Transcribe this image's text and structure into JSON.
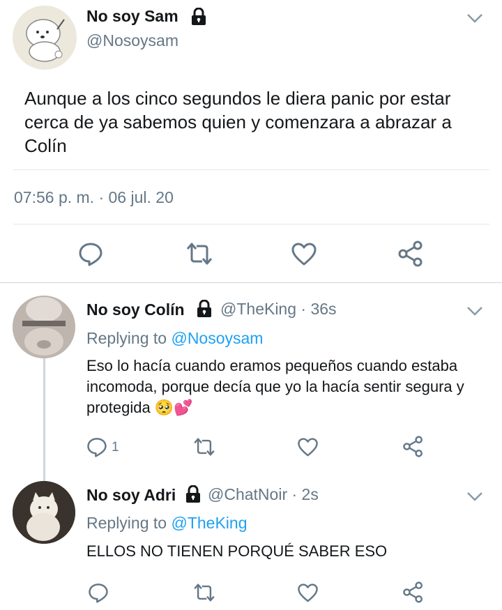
{
  "main_tweet": {
    "name": "No soy Sam",
    "handle": "@Nosoysam",
    "text": "Aunque a los cinco segundos le diera panic por estar cerca de ya sabemos quien y comenzara a abrazar a Colín",
    "timestamp": "07:56 p. m. · 06 jul. 20"
  },
  "replies": [
    {
      "name": "No soy Colín",
      "handle": "@TheKing",
      "time": "· 36s",
      "replying_label": "Replying to",
      "replying_to": "@Nosoysam",
      "text": "Eso lo hacía cuando eramos pequeños cuando estaba incomoda, porque decía que yo la hacía sentir segura y protegida 🥺💕",
      "reply_count": "1"
    },
    {
      "name": "No soy Adri",
      "handle": "@ChatNoir",
      "time": "· 2s",
      "replying_label": "Replying to",
      "replying_to": "@TheKing",
      "text": "ELLOS NO TIENEN PORQUÉ SABER ESO"
    }
  ],
  "colors": {
    "link": "#1da1f2",
    "secondary": "#657786",
    "divider": "#e1e8ed"
  },
  "icons": [
    "lock-icon",
    "chevron-down-icon",
    "reply-icon",
    "retweet-icon",
    "like-icon",
    "share-icon"
  ]
}
